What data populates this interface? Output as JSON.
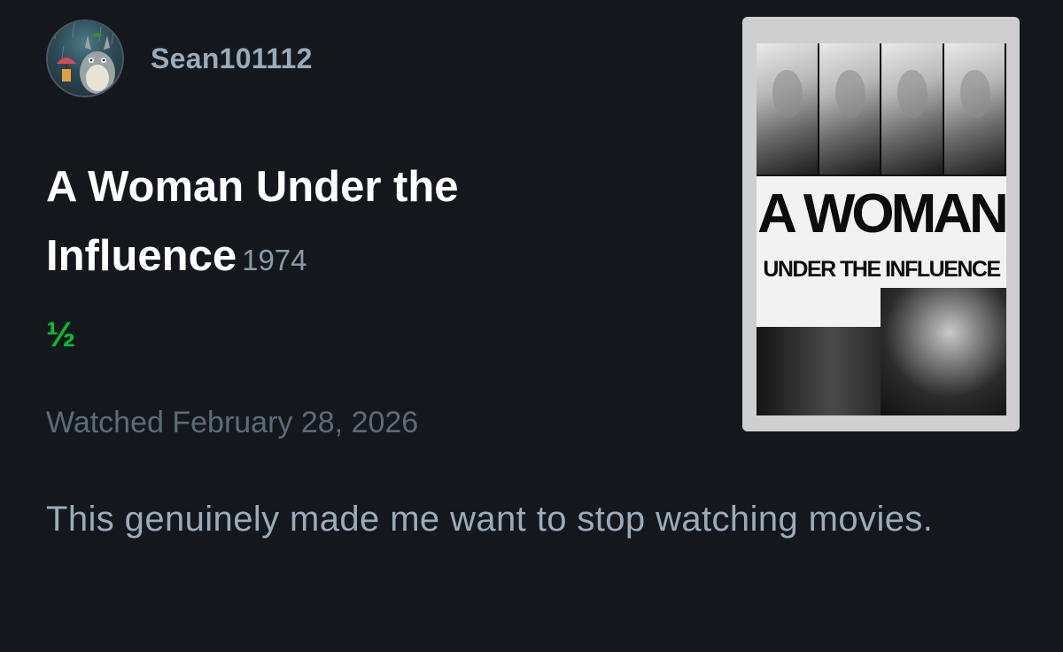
{
  "user": {
    "username": "Sean101112",
    "avatar_icon": "totoro-avatar-icon"
  },
  "film": {
    "title": "A Woman Under the Influence",
    "year": "1974"
  },
  "rating": {
    "display": "½",
    "stars": 0.5,
    "max_stars": 5,
    "color": "#00c030"
  },
  "watched": {
    "label": "Watched February 28, 2026"
  },
  "review": {
    "text": "This genuinely made me want to stop watching movies."
  },
  "poster": {
    "title_line_1": "A WOMAN",
    "title_line_2": "UNDER THE INFLUENCE"
  },
  "colors": {
    "background": "#14181c",
    "username": "#99aabb",
    "year": "#8a9aa9",
    "watched": "#5c6b79",
    "review": "#9aabbb",
    "accent_green": "#00c030"
  }
}
